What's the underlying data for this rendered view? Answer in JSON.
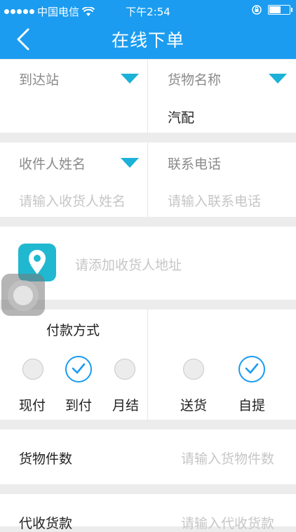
{
  "status": {
    "carrier": "中国电信",
    "time": "下午2:54"
  },
  "nav": {
    "title": "在线下单"
  },
  "section1": {
    "arrival_label": "到达站",
    "arrival_value": "",
    "goods_label": "货物名称",
    "goods_value": "汽配"
  },
  "section2": {
    "receiver_label": "收件人姓名",
    "receiver_placeholder": "请输入收货人姓名",
    "phone_label": "联系电话",
    "phone_placeholder": "请输入联系电话"
  },
  "address": {
    "placeholder": "请添加收货人地址"
  },
  "payment": {
    "title": "付款方式",
    "options": [
      {
        "label": "现付",
        "selected": false
      },
      {
        "label": "到付",
        "selected": true
      },
      {
        "label": "月结",
        "selected": false
      }
    ],
    "delivery_options": [
      {
        "label": "送货",
        "selected": false
      },
      {
        "label": "自提",
        "selected": true
      }
    ]
  },
  "pieces": {
    "label": "货物件数",
    "placeholder": "请输入货物件数"
  },
  "cod": {
    "label": "代收货款",
    "placeholder": "请输入代收货款"
  },
  "colors": {
    "primary": "#1b9cf0",
    "accent_triangle": "#1bb1d8",
    "location_icon": "#20b8d0"
  }
}
